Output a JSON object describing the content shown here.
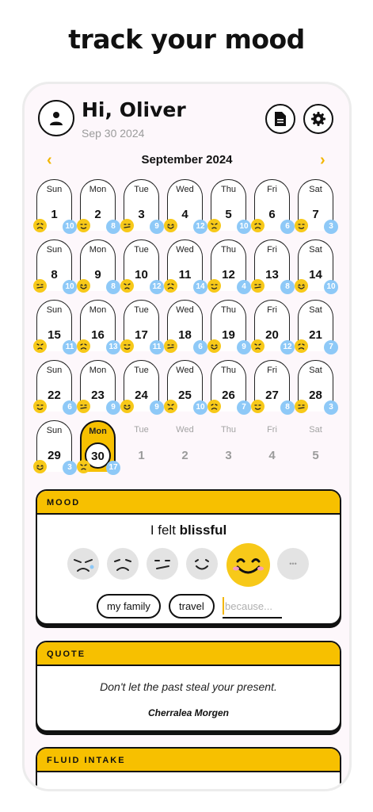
{
  "headline": "track your mood",
  "header": {
    "greeting": "Hi, Oliver",
    "date": "Sep 30 2024"
  },
  "calendar": {
    "month": "September 2024",
    "weekdays": [
      "Sun",
      "Mon",
      "Tue",
      "Wed",
      "Thu",
      "Fri",
      "Sat"
    ],
    "days": [
      {
        "d": "1",
        "c": "10"
      },
      {
        "d": "2",
        "c": "8"
      },
      {
        "d": "3",
        "c": "9"
      },
      {
        "d": "4",
        "c": "12"
      },
      {
        "d": "5",
        "c": "10"
      },
      {
        "d": "6",
        "c": "6"
      },
      {
        "d": "7",
        "c": "3"
      },
      {
        "d": "8",
        "c": "10"
      },
      {
        "d": "9",
        "c": "8"
      },
      {
        "d": "10",
        "c": "12"
      },
      {
        "d": "11",
        "c": "14"
      },
      {
        "d": "12",
        "c": "4"
      },
      {
        "d": "13",
        "c": "8"
      },
      {
        "d": "14",
        "c": "10"
      },
      {
        "d": "15",
        "c": "11"
      },
      {
        "d": "16",
        "c": "13"
      },
      {
        "d": "17",
        "c": "11"
      },
      {
        "d": "18",
        "c": "6"
      },
      {
        "d": "19",
        "c": "9"
      },
      {
        "d": "20",
        "c": "12"
      },
      {
        "d": "21",
        "c": "7"
      },
      {
        "d": "22",
        "c": "6"
      },
      {
        "d": "23",
        "c": "9"
      },
      {
        "d": "24",
        "c": "9"
      },
      {
        "d": "25",
        "c": "10"
      },
      {
        "d": "26",
        "c": "7"
      },
      {
        "d": "27",
        "c": "8"
      },
      {
        "d": "28",
        "c": "3"
      },
      {
        "d": "29",
        "c": "3"
      },
      {
        "d": "30",
        "c": "17"
      }
    ],
    "future_days": [
      "1",
      "2",
      "3",
      "4",
      "5"
    ]
  },
  "mood": {
    "section_label": "MOOD",
    "prefix": "I felt",
    "value": "blissful",
    "more_label": "•••",
    "tags": [
      "my family",
      "travel"
    ],
    "reason_placeholder": "because..."
  },
  "quote": {
    "section_label": "QUOTE",
    "text": "Don't let the past steal your present.",
    "author": "Cherralea Morgen"
  },
  "fluid": {
    "section_label": "FLUID INTAKE"
  },
  "colors": {
    "accent": "#f7c000",
    "badge": "#8ec9f7",
    "background": "#fdf7fb"
  }
}
